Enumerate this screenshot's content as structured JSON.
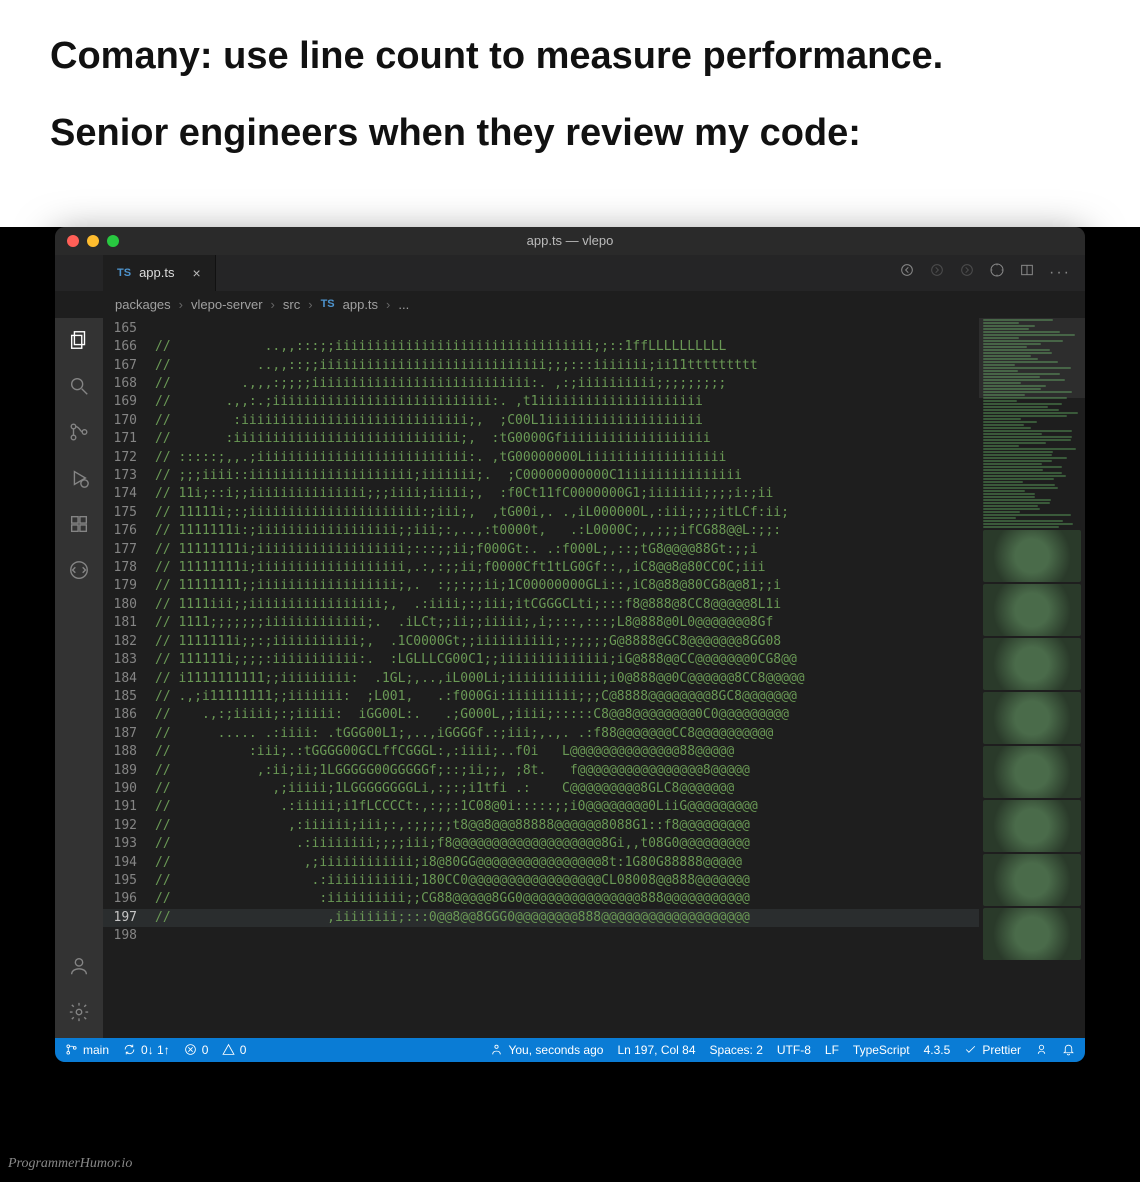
{
  "meme": {
    "line1": "Comany: use line count to measure performance.",
    "line2": "Senior engineers when they review my code:"
  },
  "window_title": "app.ts — vlepo",
  "tab": {
    "icon": "TS",
    "label": "app.ts"
  },
  "breadcrumb": [
    "packages",
    "vlepo-server",
    "src",
    "app.ts",
    "..."
  ],
  "activity_icons": [
    "files-icon",
    "search-icon",
    "git-icon",
    "debug-icon",
    "extensions-icon",
    "remote-icon"
  ],
  "activity_bottom": [
    "account-icon",
    "gear-icon"
  ],
  "tab_action_icons": [
    "go-back-icon",
    "go-fwd-icon",
    "go-fwd2-icon",
    "compass-icon",
    "split-icon",
    "more-icon"
  ],
  "cursor_line": 197,
  "lines": [
    {
      "n": 165,
      "t": ""
    },
    {
      "n": 166,
      "t": "//            ..,,:::;;iiiiiiiiiiiiiiiiiiiiiiiiiiiiiiiii;;::1ffLLLLLLLLLL"
    },
    {
      "n": 167,
      "t": "//           ..,,::;;iiiiiiiiiiiiiiiiiiiiiiiiiiiii;;;:::iiiiiii;ii11ttttttttt"
    },
    {
      "n": 168,
      "t": "//         .,,,:;;;;iiiiiiiiiiiiiiiiiiiiiiiiiiii:. ,:;iiiiiiiiii;;;;;;;;;"
    },
    {
      "n": 169,
      "t": "//       .,,:.;iiiiiiiiiiiiiiiiiiiiiiiiiiii:. ,t1iiiiiiiiiiiiiiiiiiiii"
    },
    {
      "n": 170,
      "t": "//        :iiiiiiiiiiiiiiiiiiiiiiiiiiiii;,  ;C00L1iiiiiiiiiiiiiiiiiiii"
    },
    {
      "n": 171,
      "t": "//       :iiiiiiiiiiiiiiiiiiiiiiiiiiiii;,  :tG0000Gfiiiiiiiiiiiiiiiiiii"
    },
    {
      "n": 172,
      "t": "// :::::;,,.;iiiiiiiiiiiiiiiiiiiiiiiiiii:. ,tG00000000Liiiiiiiiiiiiiiiiii"
    },
    {
      "n": 173,
      "t": "// ;;;iiii::iiiiiiiiiiiiiiiiiiiii;iiiiiii;.  ;C00000000000C1iiiiiiiiiiiiiii"
    },
    {
      "n": 174,
      "t": "// 11i;::i;;iiiiiiiiiiiiiii;;;iiii;iiiii;,  :f0Ct11fC0000000G1;iiiiiii;;;;i:;ii"
    },
    {
      "n": 175,
      "t": "// 11111i;:;iiiiiiiiiiiiiiiiiiiiii:;iii;,  ,tG00i,. .,iL000000L,:iii;;;;itLCf:ii;"
    },
    {
      "n": 176,
      "t": "// 1111111i:;iiiiiiiiiiiiiiiiii;;iii;:,..,:t0000t,   .:L0000C;,,;;;ifCG88@@L:;;:"
    },
    {
      "n": 177,
      "t": "// 11111111i;iiiiiiiiiiiiiiiiiii;:::;;ii;f000Gt:. .:f000L;,::;tG8@@@@88Gt:;;i"
    },
    {
      "n": 178,
      "t": "// 11111111i;iiiiiiiiiiiiiiiiiii,.:,:;;ii;f0000Cft1tLG0Gf::,,iC8@@8@80CC0C;iii"
    },
    {
      "n": 179,
      "t": "// 11111111;;iiiiiiiiiiiiiiiiii;,.  :;;:;;ii;1C00000000GLi::,iC8@88@80CG8@@81;;i"
    },
    {
      "n": 180,
      "t": "// 1111iii;;iiiiiiiiiiiiiiiii;,  .:iiii;:;iii;itCGGGCLti;:::f8@888@8CC8@@@@@8L1i"
    },
    {
      "n": 181,
      "t": "// 1111;;;;;;;iiiiiiiiiiiii;.  .iLCt;;ii;;iiiii;,i;:::,:::;L8@888@0L0@@@@@@@8Gf"
    },
    {
      "n": 182,
      "t": "// 1111111i;;:;iiiiiiiiiii;,  .1C0000Gt;;iiiiiiiiii;:;;;;;G@8888@GC8@@@@@@@8GG08"
    },
    {
      "n": 183,
      "t": "// 111111i;;;;:iiiiiiiiiii:.  :LGLLLCG00C1;;iiiiiiiiiiiiii;iG@888@@CC@@@@@@@0CG8@@"
    },
    {
      "n": 184,
      "t": "// i1111111111;;iiiiiiiii:  .1GL;,..,iL000Li;iiiiiiiiiiii;i0@888@@0C@@@@@@8CC8@@@@@"
    },
    {
      "n": 185,
      "t": "// .,;i11111111;;iiiiiii:  ;L001,   .:f000Gi:iiiiiiiii;;;C@8888@@@@@@@@8GC8@@@@@@@"
    },
    {
      "n": 186,
      "t": "//    .,:;iiiii;:;iiiii:  iGG00L:.   .;G000L,;iiii;:::::C8@@8@@@@@@@@0C0@@@@@@@@@"
    },
    {
      "n": 187,
      "t": "//      ..... .:iiii: .tGGG00L1;,..,iGGGGf.:;iii;,.,. .:f88@@@@@@@CC8@@@@@@@@@@"
    },
    {
      "n": 188,
      "t": "//          :iii;.:tGGGG00GCLffCGGGL:,:iiii;..f0i   L@@@@@@@@@@@@@@88@@@@@"
    },
    {
      "n": 189,
      "t": "//           ,:ii;ii;1LGGGGG00GGGGGf;::;ii;;, ;8t.   f@@@@@@@@@@@@@@@@8@@@@@"
    },
    {
      "n": 190,
      "t": "//             ,;iiiii;1LGGGGGGGGLi,:;:;i1tfi .:    C@@@@@@@@@8GLC8@@@@@@@"
    },
    {
      "n": 191,
      "t": "//              .:iiiii;i1fLCCCCt:,:;;:1C08@0i:::::;;i0@@@@@@@@0LiiG@@@@@@@@@"
    },
    {
      "n": 192,
      "t": "//               ,:iiiiii;iii;:,:;;;;;t8@@8@@@88888@@@@@@8088G1::f8@@@@@@@@@"
    },
    {
      "n": 193,
      "t": "//                .:iiiiiiii;;;;iii;f8@@@@@@@@@@@@@@@@@@@8Gi,,t08G0@@@@@@@@@"
    },
    {
      "n": 194,
      "t": "//                 ,;iiiiiiiiiiii;i8@80GG@@@@@@@@@@@@@@@@8t:1G80G88888@@@@@"
    },
    {
      "n": 195,
      "t": "//                  .:iiiiiiiiiii;180CC0@@@@@@@@@@@@@@@@@CL08008@@888@@@@@@@"
    },
    {
      "n": 196,
      "t": "//                   :iiiiiiiiii;;CG88@@@@@8GG0@@@@@@@@@@@@@@@888@@@@@@@@@@@"
    },
    {
      "n": 197,
      "t": "//                    ,iiiiiiii;:::0@@8@@8GGG0@@@@@@@@888@@@@@@@@@@@@@@@@@@@"
    },
    {
      "n": 198,
      "t": ""
    }
  ],
  "status": {
    "branch": "main",
    "sync": "0↓ 1↑",
    "errors": "0",
    "warnings": "0",
    "blame": "You, seconds ago",
    "position": "Ln 197, Col 84",
    "spaces": "Spaces: 2",
    "encoding": "UTF-8",
    "eol": "LF",
    "lang": "TypeScript",
    "version": "4.3.5",
    "prettier": "Prettier"
  },
  "watermark": "ProgrammerHumor.io"
}
